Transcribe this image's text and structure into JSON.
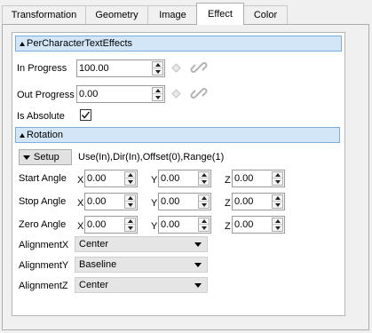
{
  "tabs": [
    {
      "label": "Transformation"
    },
    {
      "label": "Geometry"
    },
    {
      "label": "Image"
    },
    {
      "label": "Effect"
    },
    {
      "label": "Color"
    }
  ],
  "active_tab": "Effect",
  "per_character": {
    "header": "PerCharacterTextEffects",
    "in_progress_label": "In Progress",
    "in_progress_value": "100.00",
    "out_progress_label": "Out Progress",
    "out_progress_value": "0.00",
    "is_absolute_label": "Is Absolute",
    "is_absolute_checked": true
  },
  "rotation": {
    "header": "Rotation",
    "setup_label": "Setup",
    "setup_summary": "Use(In),Dir(In),Offset(0),Range(1)",
    "axis_x": "X",
    "axis_y": "Y",
    "axis_z": "Z",
    "start_label": "Start Angle",
    "start_x": "0.00",
    "start_y": "0.00",
    "start_z": "0.00",
    "stop_label": "Stop Angle",
    "stop_x": "0.00",
    "stop_y": "0.00",
    "stop_z": "0.00",
    "zero_label": "Zero Angle",
    "zero_x": "0.00",
    "zero_y": "0.00",
    "zero_z": "0.00",
    "alignment_x_label": "AlignmentX",
    "alignment_x_value": "Center",
    "alignment_y_label": "AlignmentY",
    "alignment_y_value": "Baseline",
    "alignment_z_label": "AlignmentZ",
    "alignment_z_value": "Center"
  },
  "icons": {
    "keyframe": "diamond-icon",
    "link": "link-icon"
  }
}
